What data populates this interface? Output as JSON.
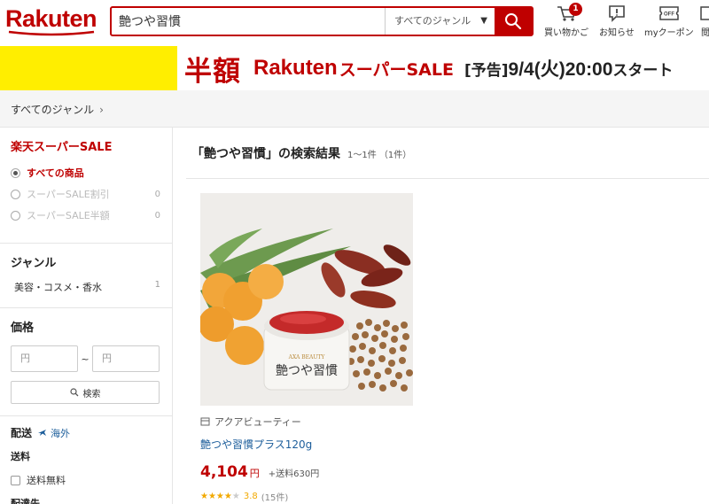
{
  "header": {
    "logo": "Rakuten",
    "search_value": "艶つや習慣",
    "genre_select": "すべてのジャンル",
    "icons": [
      {
        "name": "cart-icon",
        "label": "買い物かご",
        "badge": "1"
      },
      {
        "name": "notification-icon",
        "label": "お知らせ"
      },
      {
        "name": "coupon-icon",
        "label": "myクーポン"
      },
      {
        "name": "more-icon",
        "label": "閲"
      }
    ]
  },
  "banner": {
    "half_price": "半額",
    "brand": "Rakuten",
    "sale": "スーパーSALE",
    "notice": "[予告]",
    "datetime": "9/4(火)20:00",
    "start": "スタート",
    "colors": {
      "yellow": "#ffee00",
      "red": "#bf0000"
    }
  },
  "breadcrumb": {
    "label": "すべてのジャンル"
  },
  "sidebar": {
    "sale_title": "楽天スーパーSALE",
    "sale_options": [
      {
        "label": "すべての商品",
        "count": "",
        "selected": true
      },
      {
        "label": "スーパーSALE割引",
        "count": "0",
        "selected": false
      },
      {
        "label": "スーパーSALE半額",
        "count": "0",
        "selected": false
      }
    ],
    "genre_title": "ジャンル",
    "genres": [
      {
        "label": "美容・コスメ・香水",
        "count": "1"
      }
    ],
    "price_title": "価格",
    "price_min_placeholder": "円",
    "price_max_placeholder": "円",
    "price_separator": "~",
    "price_search": "検索",
    "delivery_title": "配送",
    "overseas": "海外",
    "shipping_title": "送料",
    "free_shipping": "送料無料",
    "destination_title": "配達先"
  },
  "main": {
    "results_title": "「艶つや習慣」の検索結果",
    "results_count": "1〜1件 （1件）",
    "product": {
      "shop": "アクアビューティー",
      "name": "艶つや習慣プラス120g",
      "price": "4,104",
      "yen": "円",
      "shipping": "+送料630円",
      "rating": "3.8",
      "rating_stars": 3.8,
      "reviews": "(15件)",
      "jar_label": "艶つや習慣"
    }
  }
}
